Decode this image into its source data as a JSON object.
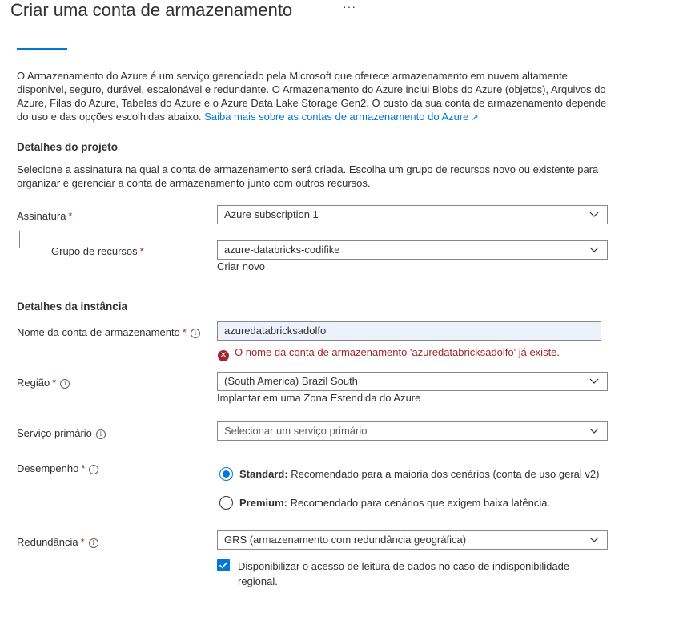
{
  "header": {
    "title": "Criar uma conta de armazenamento",
    "more": "···"
  },
  "intro": {
    "text": "O Armazenamento do Azure é um serviço gerenciado pela Microsoft que oferece armazenamento em nuvem altamente disponível, seguro, durável, escalonável e redundante. O Armazenamento do Azure inclui Blobs do Azure (objetos), Arquivos do Azure, Filas do Azure, Tabelas do Azure e o Azure Data Lake Storage Gen2. O custo da sua conta de armazenamento depende do uso e das opções escolhidas abaixo.",
    "link": "Saiba mais sobre as contas de armazenamento do Azure"
  },
  "project": {
    "title": "Detalhes do projeto",
    "description": "Selecione a assinatura na qual a conta de armazenamento será criada. Escolha um grupo de recursos novo ou existente para organizar e gerenciar a conta de armazenamento junto com outros recursos.",
    "subscription_label": "Assinatura",
    "subscription_value": "Azure subscription 1",
    "resource_group_label": "Grupo de recursos",
    "resource_group_value": "azure-databricks-codifike",
    "create_new": "Criar novo"
  },
  "instance": {
    "title": "Detalhes da instância",
    "account_name_label": "Nome da conta de armazenamento",
    "account_name_value": "azuredatabricksadolfo",
    "account_name_error": "O nome da conta de armazenamento 'azuredatabricksadolfo' já existe.",
    "region_label": "Região",
    "region_value": "(South America) Brazil South",
    "edge_zone_link": "Implantar em uma Zona Estendida do Azure",
    "primary_service_label": "Serviço primário",
    "primary_service_placeholder": "Selecionar um serviço primário",
    "performance_label": "Desempenho",
    "performance_options": [
      {
        "name": "Standard:",
        "description": "Recomendado para a maioria dos cenários (conta de uso geral v2)",
        "selected": true
      },
      {
        "name": "Premium:",
        "description": "Recomendado para cenários que exigem baixa latência.",
        "selected": false
      }
    ],
    "redundancy_label": "Redundância",
    "redundancy_value": "GRS (armazenamento com redundância geográfica)",
    "read_access_label": "Disponibilizar o acesso de leitura de dados no caso de indisponibilidade regional.",
    "read_access_checked": true
  },
  "required_marker": "*",
  "colors": {
    "accent": "#0078d4",
    "error": "#a4262c",
    "input_autofill": "#ecf1fb"
  }
}
